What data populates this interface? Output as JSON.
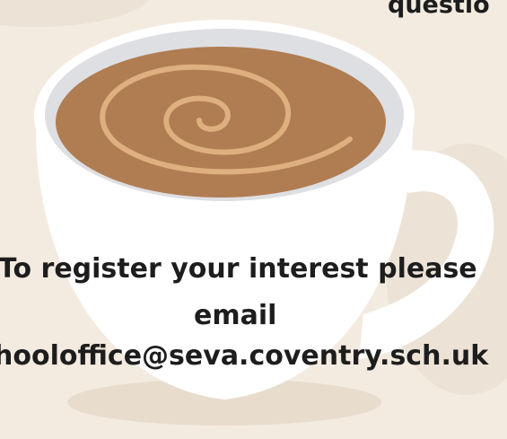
{
  "header": {
    "partial_text": "questio"
  },
  "message": {
    "line1": "To register your interest please",
    "line2": "email",
    "line3": "hooloffice@seva.coventry.sch.uk"
  },
  "colors": {
    "background": "#f3ebe0",
    "cup": "#ffffff",
    "coffee": "#b07d52",
    "swirl": "#deb07f",
    "text": "#1d1d1d"
  },
  "illustration": {
    "icon": "coffee-cup-icon"
  }
}
